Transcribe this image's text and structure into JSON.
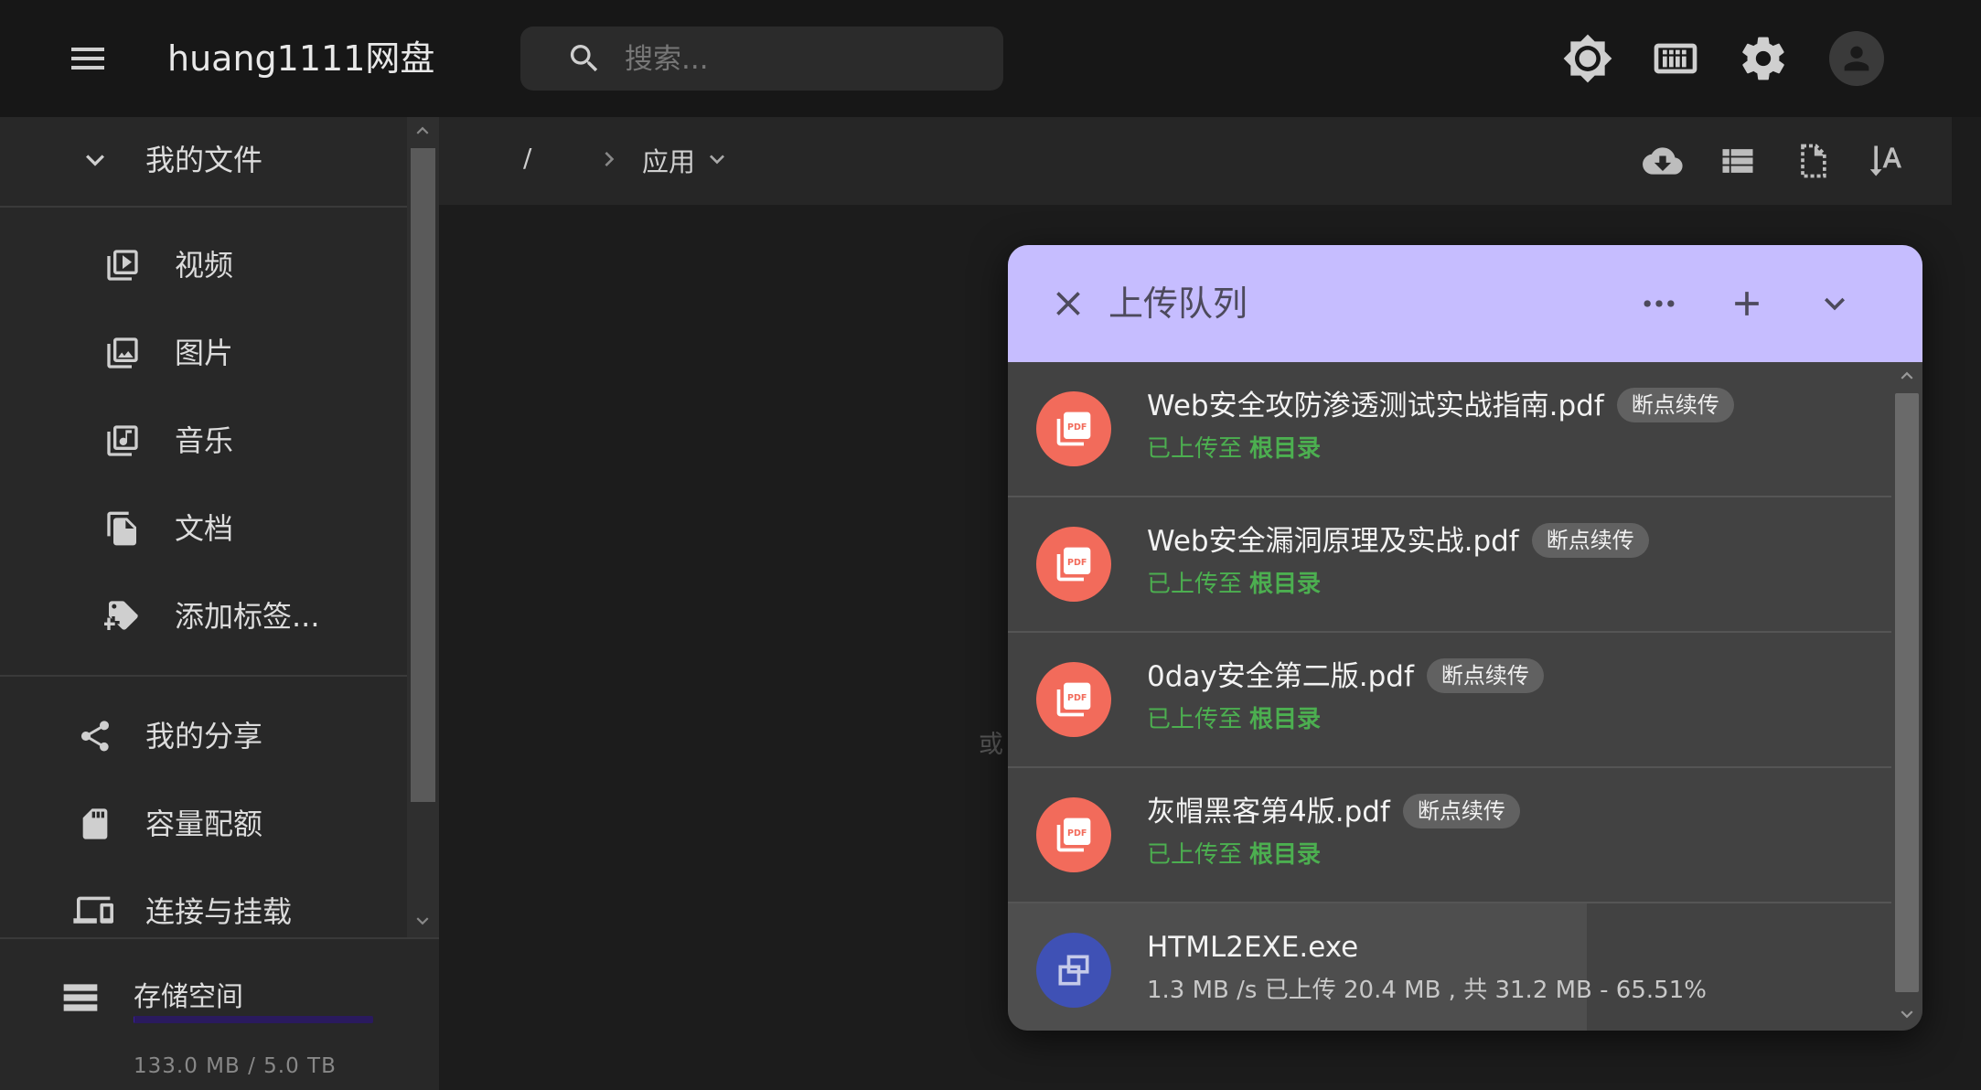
{
  "appbar": {
    "title": "huang1111网盘",
    "search_placeholder": "搜索...",
    "actions": [
      "brightness-icon",
      "keyboard-icon",
      "settings-icon"
    ],
    "avatar_icon": "account-circle-icon"
  },
  "drawer": {
    "my_files": "我的文件",
    "items": [
      {
        "label": "视频",
        "icon": "video-library-icon"
      },
      {
        "label": "图片",
        "icon": "photo-library-icon"
      },
      {
        "label": "音乐",
        "icon": "library-music-icon"
      },
      {
        "label": "文档",
        "icon": "file-copy-icon"
      },
      {
        "label": "添加标签...",
        "icon": "tag-plus-icon"
      }
    ],
    "sections": [
      {
        "label": "我的分享",
        "icon": "share-icon"
      },
      {
        "label": "容量配额",
        "icon": "sd-card-icon"
      },
      {
        "label": "连接与挂载",
        "icon": "devices-icon"
      }
    ],
    "storage": {
      "label": "存储空间",
      "usage_text": "133.0 MB / 5.0 TB",
      "fraction": 3e-05
    }
  },
  "toolbar": {
    "root": "/",
    "folder": "应用",
    "actions": [
      "cloud-download-icon",
      "list-view-icon",
      "file-dashed-icon",
      "sort-alpha-icon"
    ]
  },
  "behind_text": "或",
  "upload_panel": {
    "title": "上传队列",
    "actions": [
      "more-horizontal-icon",
      "add-icon",
      "chevron-down-icon"
    ],
    "status_prefix": "已上传至",
    "status_folder": "根目录",
    "chip_label": "断点续传",
    "items": [
      {
        "name": "Web安全攻防渗透测试实战指南.pdf",
        "type": "pdf",
        "done": true
      },
      {
        "name": "Web安全漏洞原理及实战.pdf",
        "type": "pdf",
        "done": true
      },
      {
        "name": "0day安全第二版.pdf",
        "type": "pdf",
        "done": true
      },
      {
        "name": "灰帽黑客第4版.pdf",
        "type": "pdf",
        "done": true
      },
      {
        "name": "HTML2EXE.exe",
        "type": "exe",
        "done": false,
        "progress_text": "1.3 MB /s 已上传 20.4 MB , 共 31.2 MB - 65.51%",
        "progress": 0.6551
      }
    ],
    "colors": {
      "header": "#c6bdff",
      "pdf": "#f26b5b",
      "exe": "#3f51b5",
      "done": "#4caf50"
    }
  }
}
